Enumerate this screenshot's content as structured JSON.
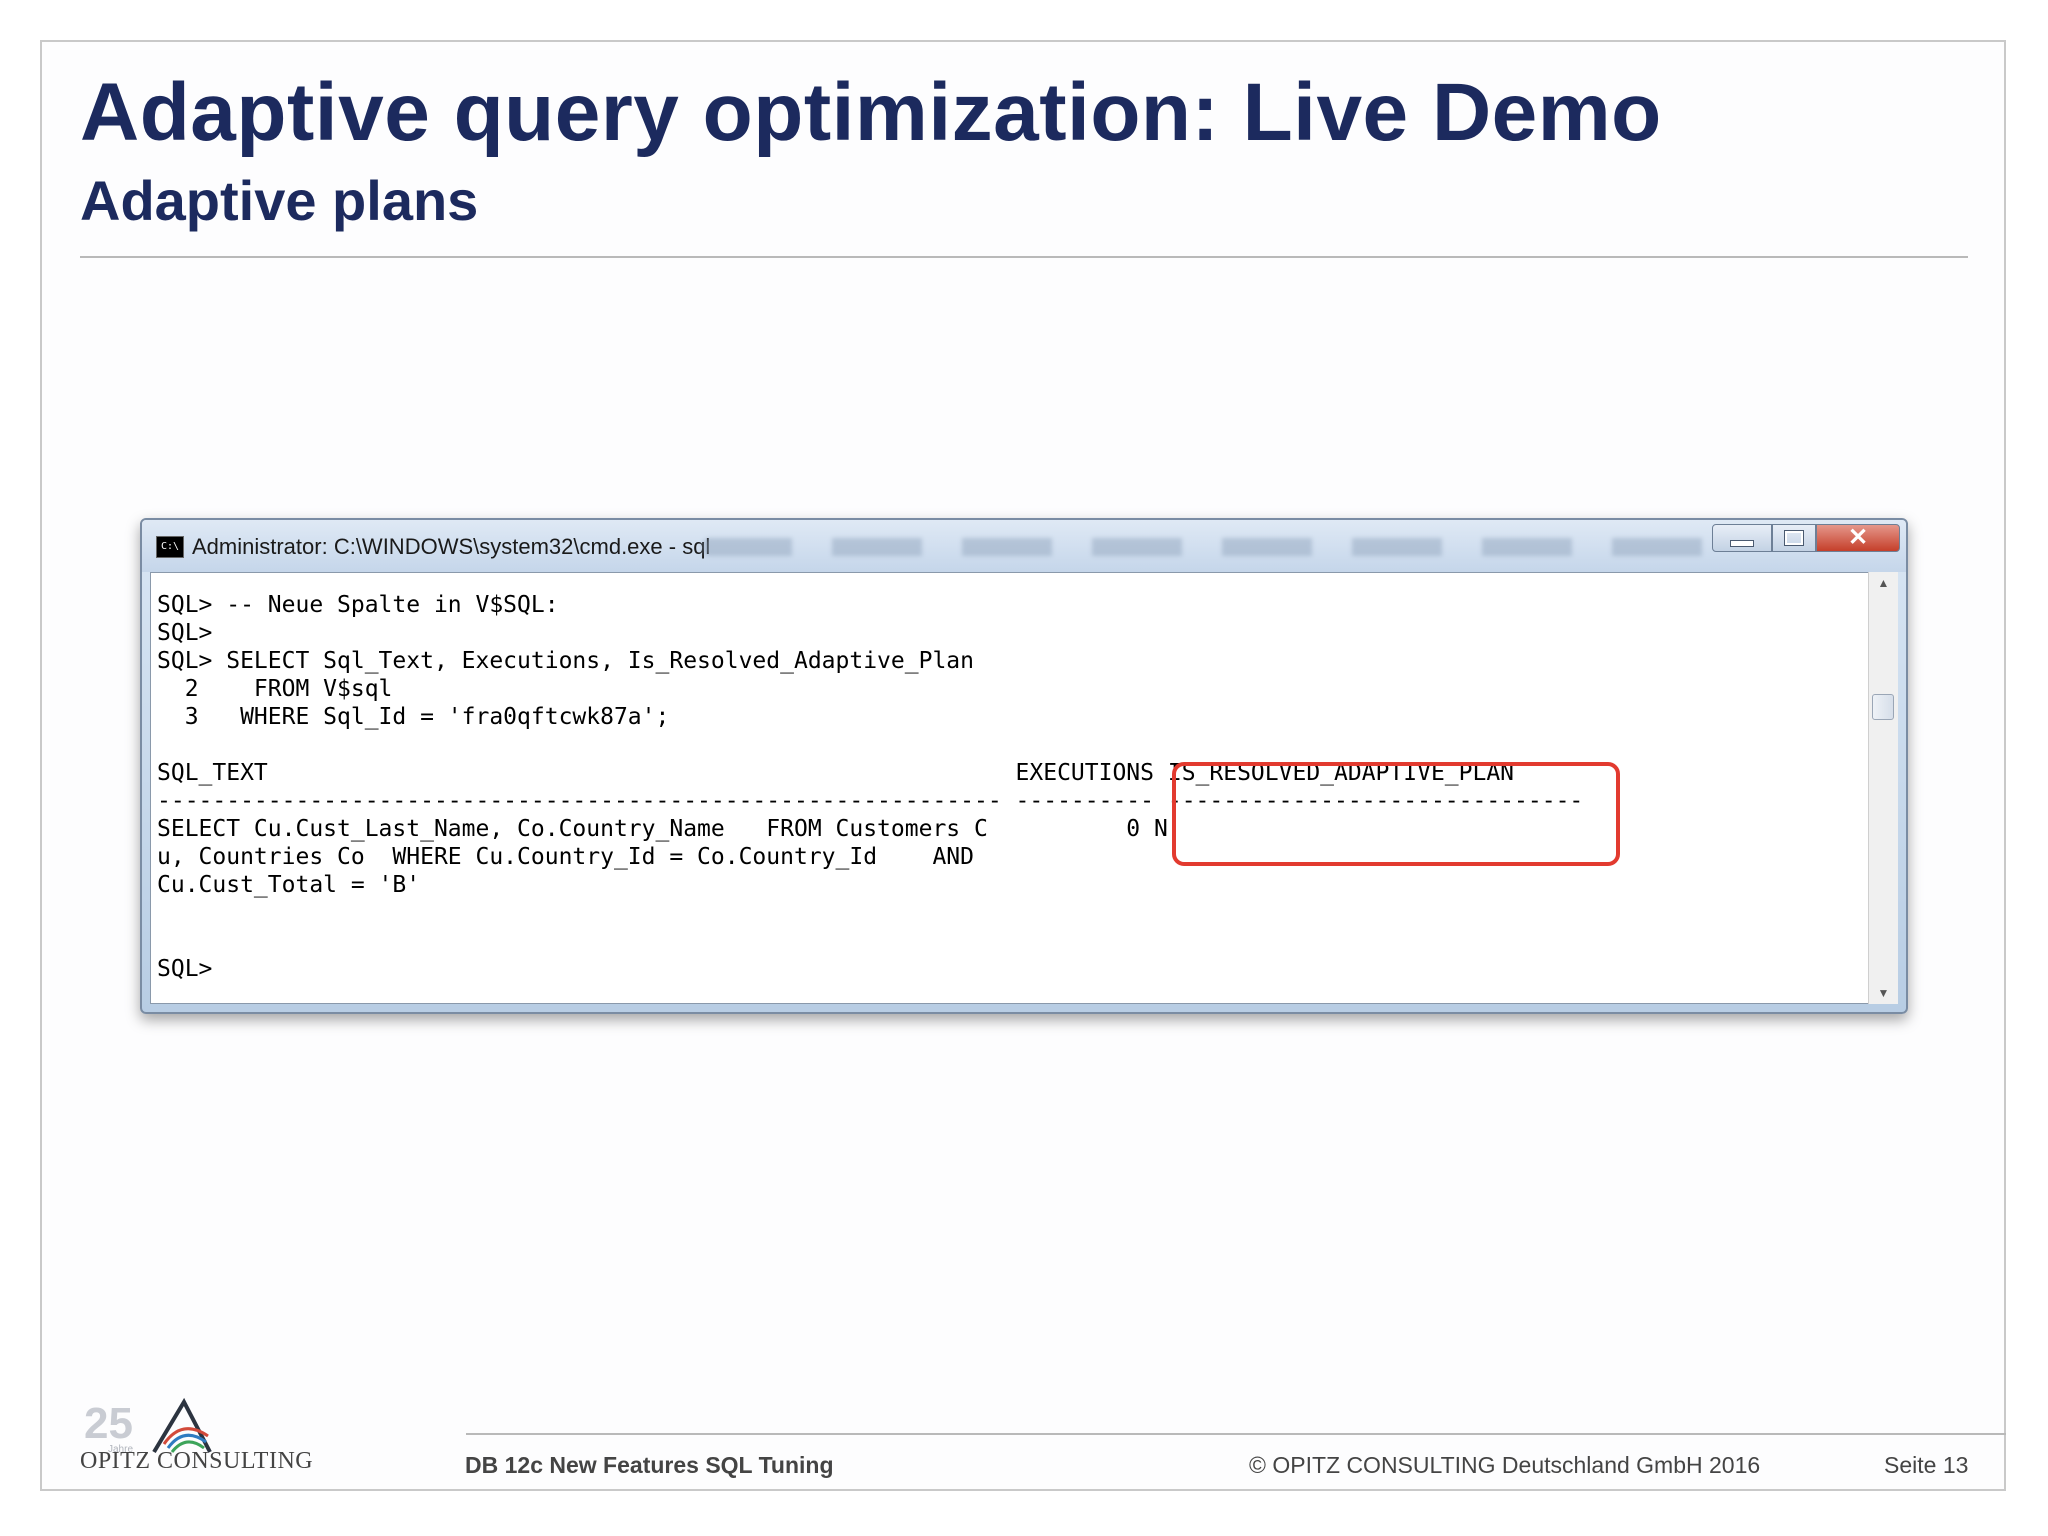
{
  "slide": {
    "title": "Adaptive query optimization: Live Demo",
    "subtitle": "Adaptive plans"
  },
  "window": {
    "title": "Administrator: C:\\WINDOWS\\system32\\cmd.exe - sql",
    "icon_label": "C:\\"
  },
  "console": {
    "lines": [
      "SQL> -- Neue Spalte in V$SQL:",
      "SQL>",
      "SQL> SELECT Sql_Text, Executions, Is_Resolved_Adaptive_Plan",
      "  2    FROM V$sql",
      "  3   WHERE Sql_Id = 'fra0qftcwk87a';",
      "",
      "SQL_TEXT                                                      EXECUTIONS IS_RESOLVED_ADAPTIVE_PLAN",
      "------------------------------------------------------------- ---------- ------------------------------",
      "SELECT Cu.Cust_Last_Name, Co.Country_Name   FROM Customers C          0 N",
      "u, Countries Co  WHERE Cu.Country_Id = Co.Country_Id    AND",
      "Cu.Cust_Total = 'B'",
      "",
      "",
      "SQL>"
    ]
  },
  "footer": {
    "logo_number": "25",
    "logo_small": "Jahre",
    "logo_text": "OPITZ CONSULTING",
    "left": "DB 12c New Features SQL Tuning",
    "copyright": "© OPITZ CONSULTING Deutschland GmbH 2016",
    "page": "Seite 13"
  },
  "colors": {
    "title": "#1c2a5e",
    "highlight": "#e23a2f",
    "close_button": "#c53f2a"
  }
}
